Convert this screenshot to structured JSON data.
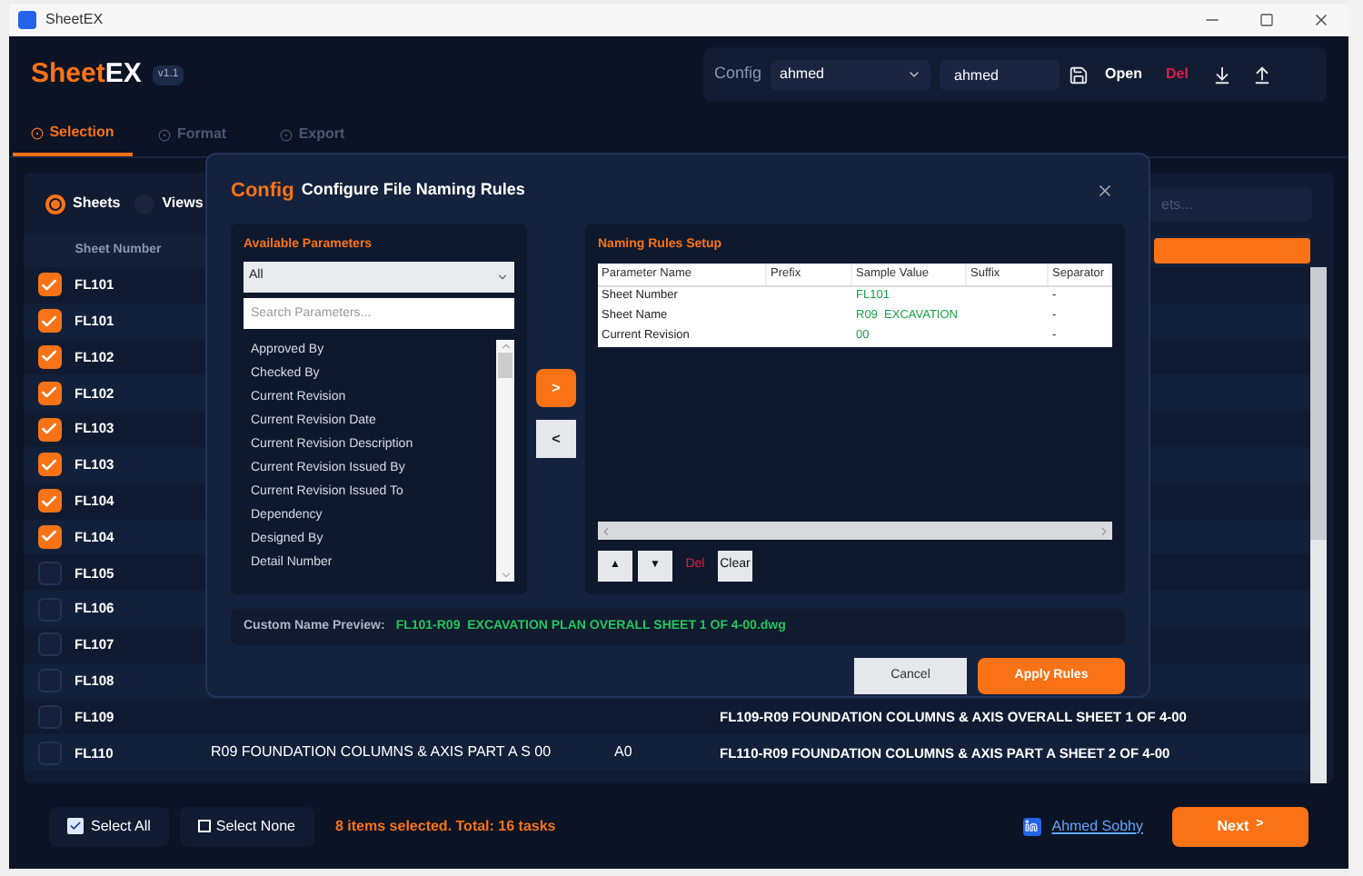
{
  "window": {
    "title": "SheetEX"
  },
  "header": {
    "logo_main": "Sheet",
    "logo_accent": "EX",
    "version": "v1.1",
    "config_label": "Config",
    "config_select": "ahmed",
    "config_name": "ahmed",
    "open_button": "Open",
    "delete_button": "Del"
  },
  "tabs": [
    {
      "label": "Selection",
      "selected": true
    },
    {
      "label": "Format",
      "selected": false
    },
    {
      "label": "Export",
      "selected": false
    }
  ],
  "view_options": [
    {
      "label": "Sheets",
      "selected": true
    },
    {
      "label": "Views",
      "selected": false
    }
  ],
  "search": {
    "placeholder": "ets..."
  },
  "table": {
    "columns": [
      "Sheet Number"
    ],
    "rows": [
      {
        "number": "FL101",
        "checked": true
      },
      {
        "number": "FL101",
        "checked": true
      },
      {
        "number": "FL102",
        "checked": true
      },
      {
        "number": "FL102",
        "checked": true
      },
      {
        "number": "FL103",
        "checked": true
      },
      {
        "number": "FL103",
        "checked": true
      },
      {
        "number": "FL104",
        "checked": true
      },
      {
        "number": "FL104",
        "checked": true
      },
      {
        "number": "FL105",
        "checked": false
      },
      {
        "number": "FL106",
        "checked": false
      },
      {
        "number": "FL107",
        "checked": false
      },
      {
        "number": "FL108",
        "checked": false
      },
      {
        "number": "FL109",
        "checked": false,
        "file_name": "FL109-R09 FOUNDATION COLUMNS & AXIS OVERALL SHEET 1 OF 4-00"
      },
      {
        "number": "FL110",
        "checked": false,
        "name": "R09 FOUNDATION COLUMNS & AXIS PART A S 00",
        "size": "A0",
        "file_name": "FL110-R09 FOUNDATION COLUMNS & AXIS PART A SHEET 2 OF 4-00"
      }
    ]
  },
  "footer": {
    "select_all": "Select All",
    "select_none": "Select None",
    "status": "8 items selected. Total: 16 tasks",
    "author_link": "Ahmed Sobhy",
    "next_button": "Next",
    "next_arrow": ">"
  },
  "dialog": {
    "title_accent": "Config",
    "title": "Configure File Naming Rules",
    "available": {
      "heading": "Available Parameters",
      "filter": "All",
      "search_placeholder": "Search Parameters...",
      "items": [
        "Approved By",
        "Checked By",
        "Current Revision",
        "Current Revision Date",
        "Current Revision Description",
        "Current Revision Issued By",
        "Current Revision Issued To",
        "Dependency",
        "Designed By",
        "Detail Number"
      ]
    },
    "add_button": ">",
    "remove_button": "<",
    "rules": {
      "heading": "Naming Rules Setup",
      "columns": [
        "Parameter Name",
        "Prefix",
        "Sample Value",
        "Suffix",
        "Separator"
      ],
      "rows": [
        {
          "parameter": "Sheet Number",
          "prefix": "",
          "sample": "FL101",
          "suffix": "",
          "separator": "-"
        },
        {
          "parameter": "Sheet Name",
          "prefix": "",
          "sample": "R09  EXCAVATION",
          "suffix": "",
          "separator": "-"
        },
        {
          "parameter": "Current Revision",
          "prefix": "",
          "sample": "00",
          "suffix": "",
          "separator": "-"
        }
      ],
      "up_button": "▲",
      "down_button": "▼",
      "delete_button": "Del",
      "clear_button": "Clear"
    },
    "preview_label": "Custom Name Preview:",
    "preview_value": "FL101-R09  EXCAVATION PLAN OVERALL SHEET 1 OF 4-00.dwg",
    "cancel_button": "Cancel",
    "apply_button": "Apply Rules"
  }
}
